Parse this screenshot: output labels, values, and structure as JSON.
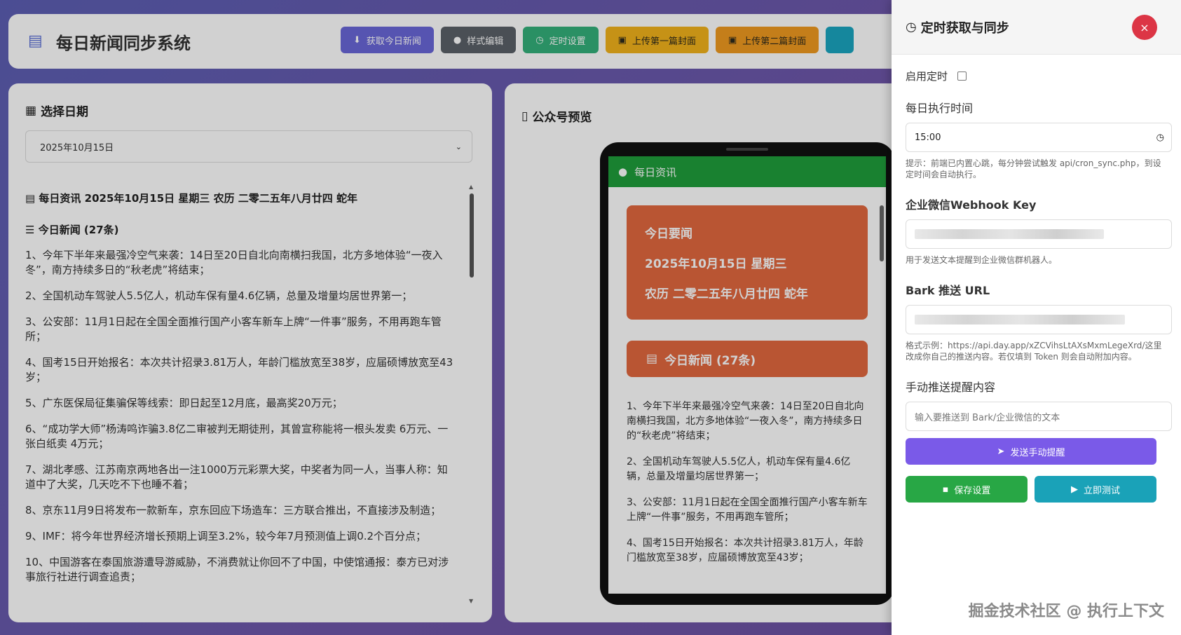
{
  "header": {
    "title": "每日新闻同步系统",
    "buttons": [
      {
        "label": "获取今日新闻",
        "icon": "download-icon",
        "color": "#6a67d8"
      },
      {
        "label": "样式编辑",
        "icon": "palette-icon",
        "color": "#5b6168"
      },
      {
        "label": "定时设置",
        "icon": "clock-icon",
        "color": "#34b07a"
      },
      {
        "label": "上传第一篇封面",
        "icon": "image-icon",
        "color": "#f2b21c"
      },
      {
        "label": "上传第二篇封面",
        "icon": "image-icon",
        "color": "#f09a20"
      }
    ]
  },
  "left": {
    "date_title": "选择日期",
    "date_value": "2025年10月15日",
    "news_header": "每日资讯 2025年10月15日 星期三 农历 二零二五年八月廿四 蛇年",
    "news_subheader": "今日新闻 (27条)",
    "items": [
      "1、今年下半年来最强冷空气来袭：14日至20日自北向南横扫我国，北方多地体验“一夜入冬”，南方持续多日的“秋老虎”将结束；",
      "2、全国机动车驾驶人5.5亿人，机动车保有量4.6亿辆，总量及增量均居世界第一；",
      "3、公安部：11月1日起在全国全面推行国产小客车新车上牌“一件事”服务，不用再跑车管所；",
      "4、国考15日开始报名：本次共计招录3.81万人，年龄门槛放宽至38岁，应届硕博放宽至43岁；",
      "5、广东医保局征集骗保等线索：即日起至12月底，最高奖20万元；",
      "6、“成功学大师”杨涛鸣诈骗3.8亿二审被判无期徒刑，其曾宣称能将一根头发卖 6万元、一张白纸卖 4万元；",
      "7、湖北孝感、江苏南京两地各出一注1000万元彩票大奖，中奖者为同一人，当事人称：知道中了大奖，几天吃不下也睡不着；",
      "8、京东11月9日将发布一款新车，京东回应下场造车：三方联合推出，不直接涉及制造；",
      "9、IMF：将今年世界经济增长预期上调至3.2%，较今年7月预测值上调0.2个百分点；",
      "10、中国游客在泰国旅游遭导游威胁，不消费就让你回不了中国，中使馆通报：泰方已对涉事旅行社进行调查追责；"
    ]
  },
  "preview": {
    "title": "公众号预览",
    "bar_title": "每日资讯",
    "card_lines": [
      "今日要闻",
      "2025年10月15日 星期三",
      "农历 二零二五年八月廿四 蛇年"
    ],
    "card2_title": "今日新闻 (27条)",
    "items": [
      "1、今年下半年来最强冷空气来袭：14日至20日自北向南横扫我国，北方多地体验“一夜入冬”，南方持续多日的“秋老虎”将结束；",
      "2、全国机动车驾驶人5.5亿人，机动车保有量4.6亿辆，总量及增量均居世界第一；",
      "3、公安部：11月1日起在全国全面推行国产小客车新车上牌“一件事”服务，不用再跑车管所；",
      "4、国考15日开始报名：本次共计招录3.81万人，年龄门槛放宽至38岁，应届硕博放宽至43岁；"
    ],
    "accent": "#e2683f",
    "bar_color": "#1f9e3b"
  },
  "drawer": {
    "title": "定时获取与同步",
    "close": "×",
    "enable_label": "启用定时",
    "time_label": "每日执行时间",
    "time_value": "15:00",
    "time_hint": "提示：前端已内置心跳，每分钟尝试触发 api/cron_sync.php，到设定时间会自动执行。",
    "webhook_label": "企业微信Webhook Key",
    "webhook_hint": "用于发送文本提醒到企业微信群机器人。",
    "bark_label": "Bark 推送 URL",
    "bark_hint": "格式示例：https://api.day.app/xZCVihsLtAXsMxmLegeXrd/这里改成你自己的推送内容。若仅填到 Token 则会自动附加内容。",
    "manual_label": "手动推送提醒内容",
    "manual_placeholder": "输入要推送到 Bark/企业微信的文本",
    "send_button": "发送手动提醒",
    "save_button": "保存设置",
    "test_button": "立即测试"
  },
  "watermark": "掘金技术社区 @ 执行上下文"
}
